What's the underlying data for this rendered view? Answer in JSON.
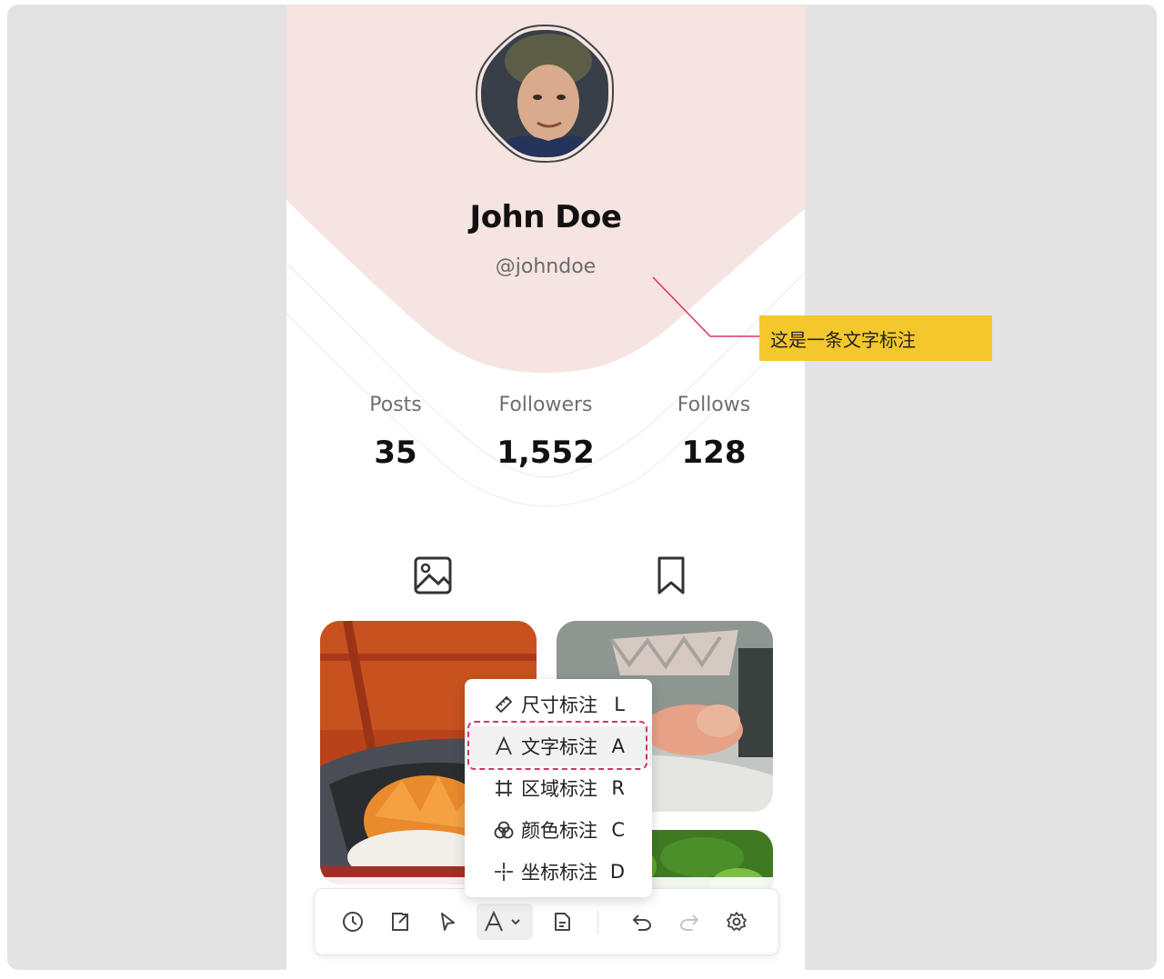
{
  "profile": {
    "name": "John Doe",
    "handle": "@johndoe"
  },
  "stats": [
    {
      "label": "Posts",
      "value": "35"
    },
    {
      "label": "Followers",
      "value": "1,552"
    },
    {
      "label": "Follows",
      "value": "128"
    }
  ],
  "tabs": [
    "image-icon",
    "bookmark-icon"
  ],
  "annotation_menu": {
    "items": [
      {
        "icon": "ruler-icon",
        "label": "尺寸标注",
        "key": "L"
      },
      {
        "icon": "text-a-icon",
        "label": "文字标注",
        "key": "A"
      },
      {
        "icon": "area-icon",
        "label": "区域标注",
        "key": "R"
      },
      {
        "icon": "color-icon",
        "label": "颜色标注",
        "key": "C"
      },
      {
        "icon": "crosshair-icon",
        "label": "坐标标注",
        "key": "D"
      }
    ],
    "selected_index": 1
  },
  "text_note": {
    "text": "这是一条文字标注"
  },
  "toolbar": {
    "buttons": [
      "history-icon",
      "export-icon",
      "pointer-icon",
      "text-annotate-icon",
      "note-icon",
      "undo-icon",
      "redo-icon",
      "settings-icon"
    ]
  },
  "colors": {
    "hero_pink": "#f6e4e1",
    "note_yellow": "#f4c72d",
    "leader_red": "#e0305c",
    "selection_red": "#d6336c"
  }
}
